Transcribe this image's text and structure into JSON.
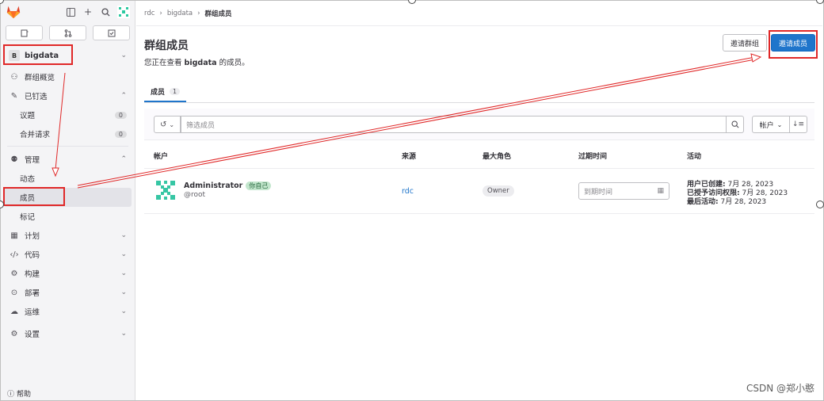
{
  "colors": {
    "accent": "#1f75cb",
    "annotation": "#e02828",
    "sidebar_bg": "#f4f4f6"
  },
  "topbar": {
    "icons": [
      "gitlab-logo",
      "sidebar-toggle-icon",
      "plus-icon",
      "search-icon",
      "user-avatar"
    ]
  },
  "quick_actions": [
    "issues-icon",
    "merge-requests-icon",
    "todos-icon"
  ],
  "group": {
    "badge": "B",
    "name": "bigdata"
  },
  "nav": {
    "overview": "群组概览",
    "pinned": "已钉选",
    "issues": "议题",
    "issues_count": "0",
    "mrs": "合并请求",
    "mrs_count": "0",
    "manage": "管理",
    "activity": "动态",
    "members": "成员",
    "labels": "标记",
    "plan": "计划",
    "code": "代码",
    "build": "构建",
    "deploy": "部署",
    "operate": "运维",
    "settings": "设置",
    "help": "帮助"
  },
  "breadcrumb": {
    "root": "rdc",
    "group": "bigdata",
    "current": "群组成员"
  },
  "page": {
    "title": "群组成员",
    "subtitle_prefix": "您正在查看 ",
    "subtitle_group": "bigdata",
    "subtitle_suffix": " 的成员。",
    "invite_group_label": "邀请群组",
    "invite_members_label": "邀请成员"
  },
  "tabs": [
    {
      "label": "成员",
      "count": "1"
    }
  ],
  "filter": {
    "placeholder": "筛选成员",
    "sort_label": "帐户"
  },
  "table": {
    "headers": [
      "帐户",
      "来源",
      "最大角色",
      "过期时间",
      "活动"
    ],
    "rows": [
      {
        "name": "Administrator",
        "you_badge": "你自己",
        "handle": "@root",
        "source": "rdc",
        "role": "Owner",
        "expiry_placeholder": "到期时间",
        "activity": [
          {
            "label": "用户已创建:",
            "value": " 7月 28, 2023"
          },
          {
            "label": "已授予访问权限:",
            "value": " 7月 28, 2023"
          },
          {
            "label": "最后活动:",
            "value": " 7月 28, 2023"
          }
        ]
      }
    ]
  },
  "watermark": "CSDN @郑小憨"
}
